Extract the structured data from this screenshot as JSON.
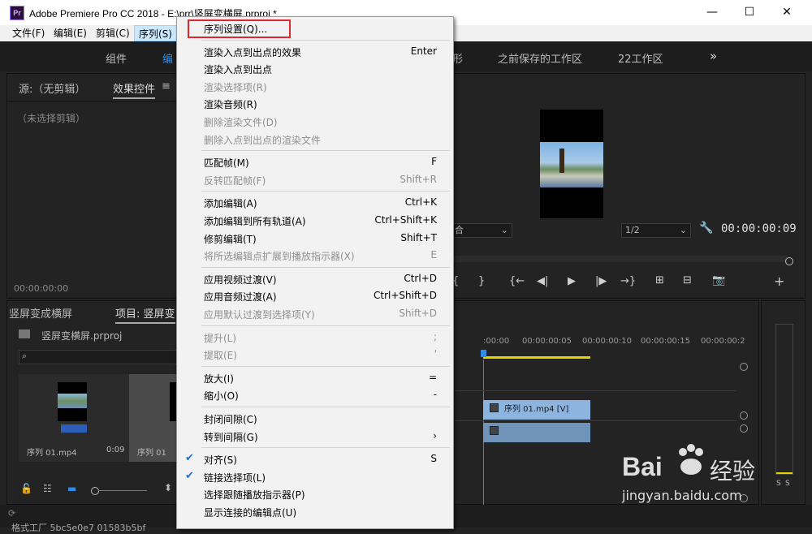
{
  "window": {
    "app_icon_text": "Pr",
    "title": "Adobe Premiere Pro CC 2018 - E:\\prr\\竖屏变横屏.prproj *",
    "controls": {
      "minimize": "—",
      "maximize": "☐",
      "close": "✕"
    }
  },
  "menubar": {
    "items": [
      "文件(F)",
      "编辑(E)",
      "剪辑(C)",
      "序列(S)"
    ]
  },
  "workspaces": {
    "items": [
      "组件",
      "编",
      "形",
      "之前保存的工作区",
      "22工作区"
    ],
    "more": "»"
  },
  "source_panel": {
    "tab_source": "源:（无剪辑）",
    "tab_effect_controls": "效果控件",
    "menu_glyph": "≡",
    "no_clip": "（未选择剪辑）",
    "timecode": "00:00:00:00"
  },
  "project_panel": {
    "tab_left": "竖屏变成横屏",
    "tab_project": "项目: 竖屏变",
    "file_name": "竖屏变横屏.prproj",
    "clips": [
      {
        "name": "序列 01.mp4",
        "duration": "0:09"
      },
      {
        "name": "序列 01",
        "duration": ""
      }
    ]
  },
  "program_monitor": {
    "fit_label": "合",
    "resolution": "1/2",
    "timecode": "00:00:00:09",
    "controls": [
      "{",
      "}",
      "{←",
      "◀|",
      "▶",
      "|▶",
      "→}",
      "⊞",
      "⊟",
      "📷",
      "+"
    ]
  },
  "timeline": {
    "ruler": [
      ":00:00",
      "00:00:00:05",
      "00:00:00:10",
      "00:00:00:15",
      "00:00:00:2"
    ],
    "video_clip_label": "序列 01.mp4 [V]",
    "meter_labels": [
      "S",
      "S"
    ]
  },
  "status_bar": {
    "text": "格式工厂     5bc5e0e7     01583b5bf"
  },
  "watermark": {
    "brand": "Bai",
    "brand_cn": "经验",
    "url": "jingyan.baidu.com"
  },
  "sequence_menu": {
    "items": [
      {
        "label": "序列设置(Q)...",
        "shortcut": "",
        "enabled": true,
        "checked": false
      },
      {
        "sep": true
      },
      {
        "label": "渲染入点到出点的效果",
        "shortcut": "Enter",
        "enabled": true,
        "checked": false
      },
      {
        "label": "渲染入点到出点",
        "shortcut": "",
        "enabled": true,
        "checked": false
      },
      {
        "label": "渲染选择项(R)",
        "shortcut": "",
        "enabled": false,
        "checked": false
      },
      {
        "label": "渲染音频(R)",
        "shortcut": "",
        "enabled": true,
        "checked": false
      },
      {
        "label": "删除渲染文件(D)",
        "shortcut": "",
        "enabled": false,
        "checked": false
      },
      {
        "label": "删除入点到出点的渲染文件",
        "shortcut": "",
        "enabled": false,
        "checked": false
      },
      {
        "sep": true
      },
      {
        "label": "匹配帧(M)",
        "shortcut": "F",
        "enabled": true,
        "checked": false
      },
      {
        "label": "反转匹配帧(F)",
        "shortcut": "Shift+R",
        "enabled": false,
        "checked": false
      },
      {
        "sep": true
      },
      {
        "label": "添加编辑(A)",
        "shortcut": "Ctrl+K",
        "enabled": true,
        "checked": false
      },
      {
        "label": "添加编辑到所有轨道(A)",
        "shortcut": "Ctrl+Shift+K",
        "enabled": true,
        "checked": false
      },
      {
        "label": "修剪编辑(T)",
        "shortcut": "Shift+T",
        "enabled": true,
        "checked": false
      },
      {
        "label": "将所选编辑点扩展到播放指示器(X)",
        "shortcut": "E",
        "enabled": false,
        "checked": false
      },
      {
        "sep": true
      },
      {
        "label": "应用视频过渡(V)",
        "shortcut": "Ctrl+D",
        "enabled": true,
        "checked": false
      },
      {
        "label": "应用音频过渡(A)",
        "shortcut": "Ctrl+Shift+D",
        "enabled": true,
        "checked": false
      },
      {
        "label": "应用默认过渡到选择项(Y)",
        "shortcut": "Shift+D",
        "enabled": false,
        "checked": false
      },
      {
        "sep": true
      },
      {
        "label": "提升(L)",
        "shortcut": ";",
        "enabled": false,
        "checked": false
      },
      {
        "label": "提取(E)",
        "shortcut": "'",
        "enabled": false,
        "checked": false
      },
      {
        "sep": true
      },
      {
        "label": "放大(I)",
        "shortcut": "=",
        "enabled": true,
        "checked": false
      },
      {
        "label": "缩小(O)",
        "shortcut": "-",
        "enabled": true,
        "checked": false
      },
      {
        "sep": true
      },
      {
        "label": "封闭间隙(C)",
        "shortcut": "",
        "enabled": true,
        "checked": false
      },
      {
        "label": "转到间隔(G)",
        "shortcut": "›",
        "enabled": true,
        "checked": false
      },
      {
        "sep": true
      },
      {
        "label": "对齐(S)",
        "shortcut": "S",
        "enabled": true,
        "checked": true
      },
      {
        "label": "链接选择项(L)",
        "shortcut": "",
        "enabled": true,
        "checked": true
      },
      {
        "label": "选择跟随播放指示器(P)",
        "shortcut": "",
        "enabled": true,
        "checked": false
      },
      {
        "label": "显示连接的编辑点(U)",
        "shortcut": "",
        "enabled": true,
        "checked": false
      }
    ]
  },
  "colors": {
    "accent": "#2d8ceb",
    "highlight_box": "#e0262f",
    "clip_blue": "#8cb4df",
    "playhead": "#2d8ceb",
    "work_area": "#e6d200"
  }
}
